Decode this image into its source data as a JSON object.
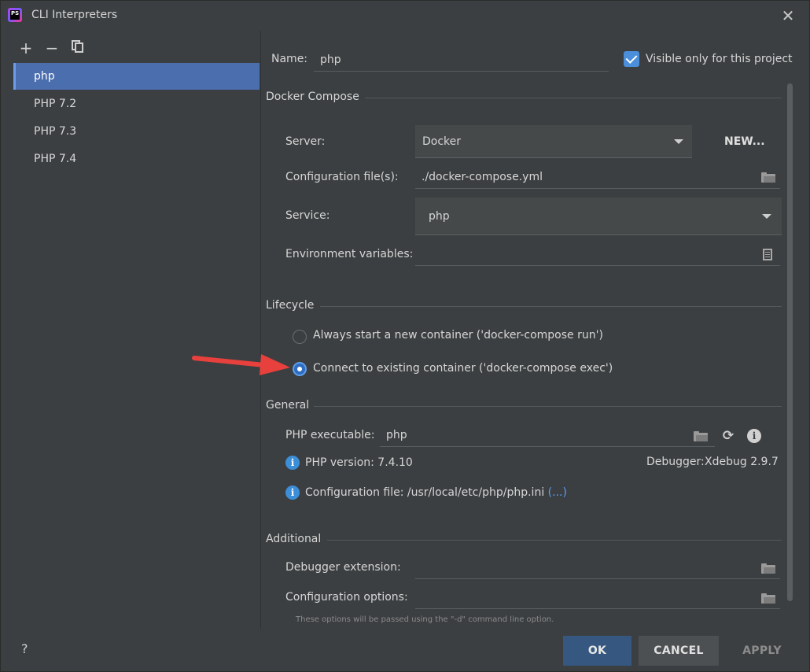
{
  "window": {
    "title": "CLI Interpreters",
    "app_icon_text": "PS"
  },
  "left": {
    "items": [
      {
        "label": "php",
        "selected": true
      },
      {
        "label": "PHP 7.2",
        "selected": false
      },
      {
        "label": "PHP 7.3",
        "selected": false
      },
      {
        "label": "PHP 7.4",
        "selected": false
      }
    ],
    "add": "+",
    "remove": "−"
  },
  "name": {
    "label": "Name:",
    "value": "php"
  },
  "visible_only": {
    "label": "Visible only for this project",
    "checked": true
  },
  "docker": {
    "title": "Docker Compose",
    "server_label": "Server:",
    "server_value": "Docker",
    "new_label": "NEW...",
    "config_label": "Configuration file(s):",
    "config_value": "./docker-compose.yml",
    "service_label": "Service:",
    "service_value": "php",
    "env_label": "Environment variables:",
    "env_value": ""
  },
  "lifecycle": {
    "title": "Lifecycle",
    "option1": "Always start a new container ('docker-compose run')",
    "option2": "Connect to existing container ('docker-compose exec')",
    "selected": 2
  },
  "general": {
    "title": "General",
    "exec_label": "PHP executable:",
    "exec_value": "php",
    "version_text": "PHP version: 7.4.10",
    "debugger_label": "Debugger:",
    "debugger_value": "Xdebug 2.9.7",
    "config_text": "Configuration file: /usr/local/etc/php/php.ini",
    "config_link": "(...)"
  },
  "additional": {
    "title": "Additional",
    "debug_ext_label": "Debugger extension:",
    "config_opts_label": "Configuration options:",
    "hint": "These options will be passed using the \"-d\" command line option."
  },
  "footer": {
    "help": "?",
    "ok": "OK",
    "cancel": "CANCEL",
    "apply": "APPLY"
  },
  "colors": {
    "accent": "#4b6eaf",
    "ok_button": "#365880",
    "link": "#589df6",
    "arrow": "#e8403c"
  }
}
